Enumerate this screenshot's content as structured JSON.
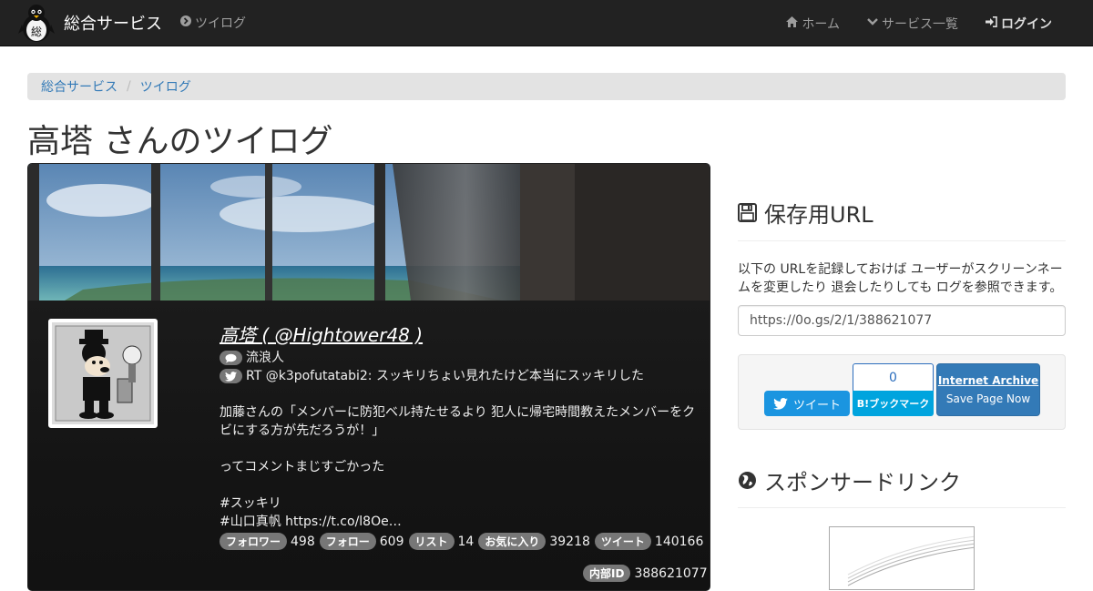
{
  "navbar": {
    "brand": "総合サービス",
    "left_link": "ツイログ",
    "items": [
      {
        "icon": "home-icon",
        "label": "ホーム"
      },
      {
        "icon": "chevron-down-icon",
        "label": "サービス一覧"
      },
      {
        "icon": "sign-in-icon",
        "label": "ログイン"
      }
    ]
  },
  "breadcrumb": [
    "総合サービス",
    "ツイログ"
  ],
  "page_title": "高塔 さんのツイログ",
  "profile": {
    "name_link": "高塔 ( @Hightower48 )",
    "location": "流浪人",
    "tweet_lines": [
      "RT @k3pofutatabi2: スッキリちょい見れたけど本当にスッキリした",
      "",
      "加藤さんの「メンバーに防犯ベル持たせるより 犯人に帰宅時間教えたメンバーをクビにする方が先だろうが！」",
      "",
      "ってコメントまじすごかった",
      "",
      "#スッキリ",
      "#山口真帆 https://t.co/l8Oe…"
    ],
    "stats": [
      {
        "label": "フォロワー",
        "value": "498"
      },
      {
        "label": "フォロー",
        "value": "609"
      },
      {
        "label": "リスト",
        "value": "14"
      },
      {
        "label": "お気に入り",
        "value": "39218"
      },
      {
        "label": "ツイート",
        "value": "140166"
      }
    ],
    "internal_id_label": "内部ID",
    "internal_id_value": "388621077"
  },
  "sidebar": {
    "save_title": "保存用URL",
    "save_desc": "以下の URLを記録しておけば ユーザーがスクリーンネームを変更したり 退会したりしても ログを参照できます。",
    "save_url": "https://0o.gs/2/1/388621077",
    "tweet_button": "ツイート",
    "hatena_count": "0",
    "hatena_button": "B!ブックマーク",
    "ia_title": "Internet Archive",
    "ia_sub": "Save Page Now",
    "sponsor_title": "スポンサードリンク"
  },
  "colors": {
    "navbar_bg": "#222222",
    "link_blue": "#337ab7",
    "twitter_blue": "#1b95e0",
    "hatena_blue": "#00a4de",
    "badge_gray": "#777777"
  }
}
